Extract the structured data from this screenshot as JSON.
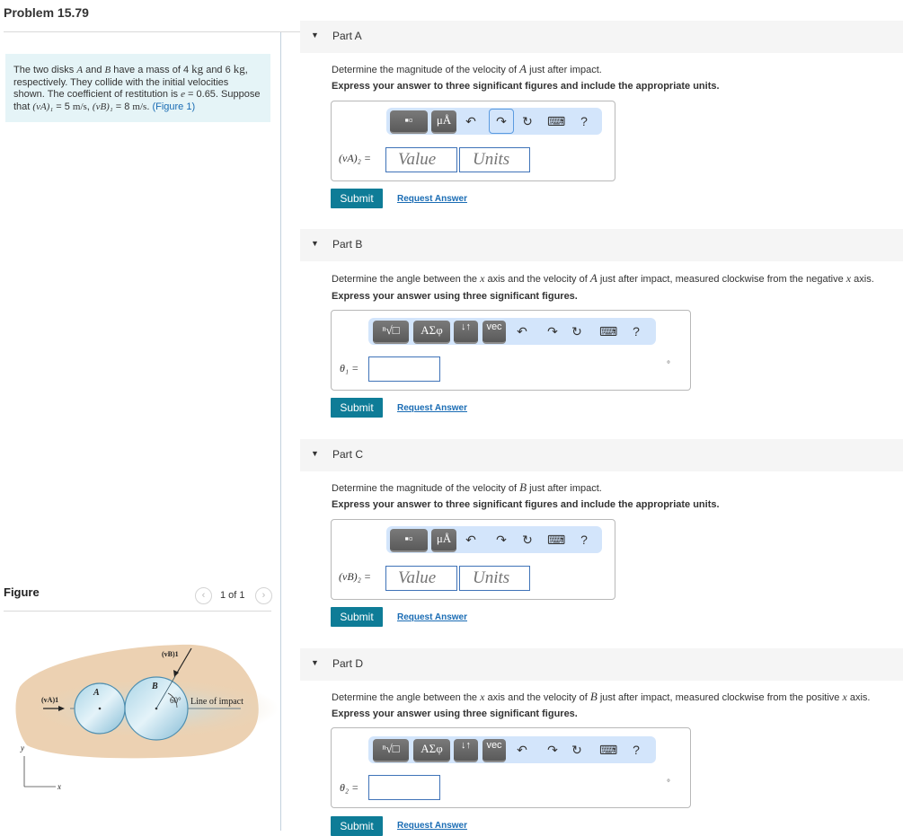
{
  "header": {
    "title": "Problem 15.79"
  },
  "problem": {
    "text_1": "The two disks ",
    "var_A": "A",
    "text_2": " and ",
    "var_B": "B",
    "text_3": " have a mass of 4 ",
    "unit_kg_1": "kg",
    "text_4": " and 6 ",
    "unit_kg_2": "kg",
    "text_5": ", respectively. They collide with the initial velocities shown. The coefficient of restitution is ",
    "var_e": "e",
    "text_6": " = 0.65. Suppose that ",
    "vA1": "(vA)₁",
    "text_7": " = 5 ",
    "unit_ms_1": "m/s",
    "text_8": ", ",
    "vB1": "(vB)₁",
    "text_9": " = 8 ",
    "unit_ms_2": "m/s",
    "text_10": ". ",
    "figure_link": "(Figure 1)"
  },
  "figure": {
    "title": "Figure",
    "counter": "1 of 1",
    "prev_icon": "chevron-left-icon",
    "next_icon": "chevron-right-icon",
    "labels": {
      "vA1": "(vA)1",
      "vB1": "(vB)1",
      "disk_a": "A",
      "disk_b": "B",
      "angle": "60°",
      "line_of_impact": "Line of impact",
      "axis_x": "x",
      "axis_y": "y"
    }
  },
  "parts": [
    {
      "title": "Part A",
      "prompt_1": "Determine the magnitude of the velocity of ",
      "prompt_var": "A",
      "prompt_2": " just after impact.",
      "instruction": "Express your answer to three significant figures and include the appropriate units.",
      "label": "(vA)₂ =",
      "value_placeholder": "Value",
      "units_placeholder": "Units",
      "submit": "Submit",
      "request": "Request Answer"
    },
    {
      "title": "Part B",
      "prompt_1": "Determine the angle between the ",
      "prompt_var_x1": "x",
      "prompt_2": " axis and the velocity of ",
      "prompt_var": "A",
      "prompt_3": " just after impact, measured clockwise from the negative ",
      "prompt_var_x2": "x",
      "prompt_4": " axis.",
      "instruction": "Express your answer using three significant figures.",
      "label": "θ₁ =",
      "unit": "°",
      "submit": "Submit",
      "request": "Request Answer"
    },
    {
      "title": "Part C",
      "prompt_1": "Determine the magnitude of the velocity of ",
      "prompt_var": "B",
      "prompt_2": " just after impact.",
      "instruction": "Express your answer to three significant figures and include the appropriate units.",
      "label": "(vB)₂ =",
      "value_placeholder": "Value",
      "units_placeholder": "Units",
      "submit": "Submit",
      "request": "Request Answer"
    },
    {
      "title": "Part D",
      "prompt_1": "Determine the angle between the ",
      "prompt_var_x1": "x",
      "prompt_2": " axis and the velocity of ",
      "prompt_var": "B",
      "prompt_3": " just after impact, measured clockwise from the positive ",
      "prompt_var_x2": "x",
      "prompt_4": " axis.",
      "instruction": "Express your answer using three significant figures.",
      "label": "θ₂ =",
      "unit": "°",
      "submit": "Submit",
      "request": "Request Answer"
    }
  ],
  "toolbar": {
    "templates_label": "▪▫",
    "units_label": "μÅ",
    "root_label": "ⁿ√□",
    "greek_label": "ΑΣφ",
    "arrows_label": "↓↑",
    "vec_label": "vec",
    "undo": "↶",
    "redo": "↷",
    "reset": "↻",
    "keyboard": "⌨",
    "help": "?"
  },
  "colors": {
    "accent": "#0e7c97",
    "link": "#1a6cb4",
    "statement_bg": "#e5f4f7",
    "toolbar_bg": "#d3e5fb",
    "input_border": "#3f73b8"
  }
}
